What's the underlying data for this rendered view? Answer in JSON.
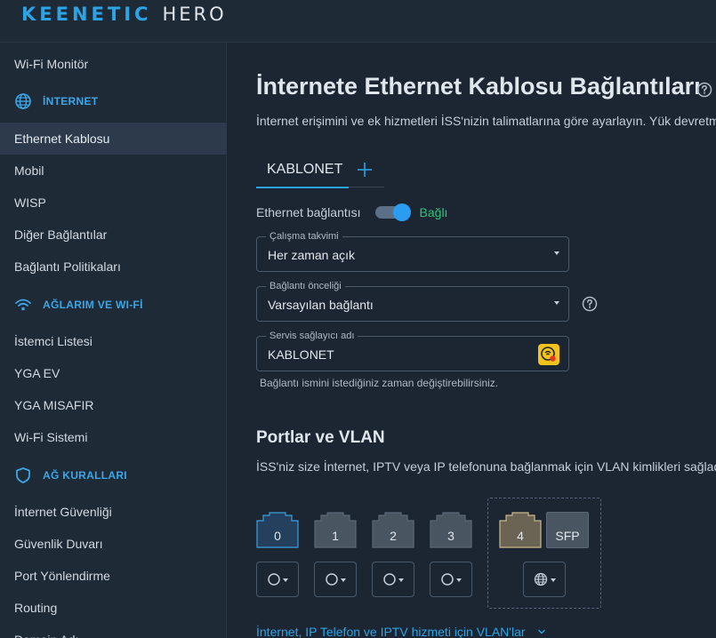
{
  "header": {
    "brand": "KEENETIC",
    "model": "HERO"
  },
  "sidebar": {
    "items": [
      {
        "label": "Wi-Fi Monitör",
        "active": false
      },
      {
        "label": "Ethernet Kablosu",
        "active": true
      },
      {
        "label": "Mobil",
        "active": false
      },
      {
        "label": "WISP",
        "active": false
      },
      {
        "label": "Diğer Bağlantılar",
        "active": false
      },
      {
        "label": "Bağlantı Politikaları",
        "active": false
      },
      {
        "label": "İstemci Listesi",
        "active": false
      },
      {
        "label": "YGA EV",
        "active": false
      },
      {
        "label": "YGA MISAFIR",
        "active": false
      },
      {
        "label": "Wi-Fi Sistemi",
        "active": false
      },
      {
        "label": "İnternet Güvenliği",
        "active": false
      },
      {
        "label": "Güvenlik Duvarı",
        "active": false
      },
      {
        "label": "Port Yönlendirme",
        "active": false
      },
      {
        "label": "Routing",
        "active": false
      },
      {
        "label": "Domain Adı",
        "active": false
      }
    ],
    "sections": [
      {
        "label": "İNTERNET",
        "icon": "globe-icon"
      },
      {
        "label": "AĞLARIM VE WI-Fİ",
        "icon": "wifi-icon"
      },
      {
        "label": "AĞ KURALLARI",
        "icon": "shield-icon"
      }
    ]
  },
  "main": {
    "title": "İnternete Ethernet Kablosu Bağlantıları",
    "subtitle": "İnternet erişimini ve ek hizmetleri İSS'nizin talimatlarına göre ayarlayın. Yük devretme",
    "tabs": [
      {
        "label": "KABLONET",
        "active": true
      }
    ],
    "connection": {
      "label": "Ethernet bağlantısı",
      "enabled": true,
      "status": "Bağlı"
    },
    "schedule": {
      "label": "Çalışma takvimi",
      "value": "Her zaman açık"
    },
    "priority": {
      "label": "Bağlantı önceliği",
      "value": "Varsayılan bağlantı"
    },
    "provider": {
      "label": "Servis sağlayıcı adı",
      "value": "KABLONET"
    },
    "hint": "Bağlantı ismini istediğiniz zaman değiştirebilirsiniz.",
    "ports_section": {
      "title": "Portlar ve VLAN",
      "subtitle": "İSS'niz size İnternet, IPTV veya IP telefonuna bağlanmak için VLAN kimlikleri sağladı",
      "ports": [
        {
          "label": "0",
          "state": "selected"
        },
        {
          "label": "1",
          "state": "normal"
        },
        {
          "label": "2",
          "state": "normal"
        },
        {
          "label": "3",
          "state": "normal"
        },
        {
          "label": "4",
          "state": "wan"
        }
      ],
      "sfp_label": "SFP",
      "vlan_link": "İnternet, IP Telefon ve IPTV hizmeti için VLAN'lar"
    }
  },
  "colors": {
    "accent": "#2aa4e6",
    "connected": "#33c37a",
    "background": "#1c2633",
    "sidebar": "#1f2a37"
  }
}
